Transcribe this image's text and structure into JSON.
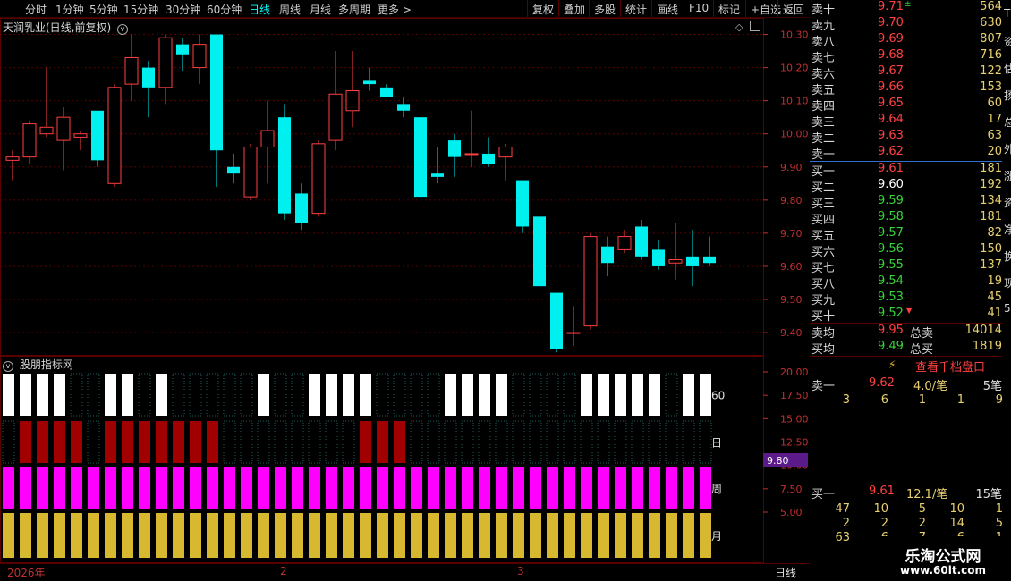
{
  "toolbar": {
    "periods": [
      "分时",
      "1分钟",
      "5分钟",
      "15分钟",
      "30分钟",
      "60分钟",
      "日线",
      "周线",
      "月线",
      "多周期",
      "更多 >"
    ],
    "active_period": "日线",
    "buttons": [
      "复权",
      "叠加",
      "多股",
      "统计",
      "画线",
      "F10",
      "标记",
      "+自选",
      "返回"
    ]
  },
  "main_chart": {
    "title": "天润乳业(日线,前复权)",
    "y_ticks": [
      "10.30",
      "10.20",
      "10.10",
      "10.00",
      "9.90",
      "9.80",
      "9.70",
      "9.60",
      "9.50",
      "9.40"
    ]
  },
  "sub_chart": {
    "title": "股朋指标网",
    "y_ticks": [
      "20.00",
      "17.50",
      "15.00",
      "12.50",
      "10.00",
      "7.50",
      "5.00"
    ],
    "row_labels": [
      "60",
      "日",
      "周",
      "月"
    ],
    "current_price_tag": "9.80"
  },
  "footer": {
    "date_labels": [
      "2026年",
      "2",
      "3"
    ],
    "period": "日线"
  },
  "order_book": {
    "asks": [
      {
        "label": "卖十",
        "price": "9.71",
        "vol": "564",
        "mark": "±"
      },
      {
        "label": "卖九",
        "price": "9.70",
        "vol": "630"
      },
      {
        "label": "卖八",
        "price": "9.69",
        "vol": "807"
      },
      {
        "label": "卖七",
        "price": "9.68",
        "vol": "716"
      },
      {
        "label": "卖六",
        "price": "9.67",
        "vol": "122"
      },
      {
        "label": "卖五",
        "price": "9.66",
        "vol": "153"
      },
      {
        "label": "卖四",
        "price": "9.65",
        "vol": "60"
      },
      {
        "label": "卖三",
        "price": "9.64",
        "vol": "17"
      },
      {
        "label": "卖二",
        "price": "9.63",
        "vol": "63"
      },
      {
        "label": "卖一",
        "price": "9.62",
        "vol": "20"
      }
    ],
    "bids": [
      {
        "label": "买一",
        "price": "9.61",
        "vol": "181"
      },
      {
        "label": "买二",
        "price": "9.60",
        "vol": "192"
      },
      {
        "label": "买三",
        "price": "9.59",
        "vol": "134"
      },
      {
        "label": "买四",
        "price": "9.58",
        "vol": "181"
      },
      {
        "label": "买五",
        "price": "9.57",
        "vol": "82"
      },
      {
        "label": "买六",
        "price": "9.56",
        "vol": "150"
      },
      {
        "label": "买七",
        "price": "9.55",
        "vol": "137"
      },
      {
        "label": "买八",
        "price": "9.54",
        "vol": "19"
      },
      {
        "label": "买九",
        "price": "9.53",
        "vol": "45"
      },
      {
        "label": "买十",
        "price": "9.52",
        "vol": "41"
      }
    ],
    "ask_avg_label": "卖均",
    "ask_avg": "9.95",
    "ask_total_label": "总卖",
    "ask_total": "14014",
    "bid_avg_label": "买均",
    "bid_avg": "9.49",
    "bid_total_label": "总买",
    "bid_total": "1819",
    "thousand_link": "查看千档盘口",
    "sell1_label": "卖一",
    "sell1_price": "9.62",
    "sell1_avg": "4.0/笔",
    "sell1_count": "5笔",
    "sell1_queue": [
      "3",
      "6",
      "1",
      "1",
      "9"
    ],
    "buy1_label": "买一",
    "buy1_price": "9.61",
    "buy1_avg": "12.1/笔",
    "buy1_count": "15笔",
    "buy1_queue": [
      [
        "47",
        "10",
        "5",
        "10",
        "1"
      ],
      [
        "2",
        "2",
        "2",
        "14",
        "5"
      ],
      [
        "63",
        "6",
        "7",
        "6",
        "1"
      ]
    ],
    "side_chars": [
      "T",
      "资",
      "估",
      "扬",
      "总",
      "外",
      "涨",
      "资",
      "净",
      "换",
      "现",
      "5"
    ]
  },
  "logo": {
    "title": "乐淘公式网",
    "url": "www.60lt.com"
  },
  "colors": {
    "up": "#ff4040",
    "down": "#00f0f0",
    "grid": "#5a0000",
    "bg": "#000000",
    "magenta": "#ff00ff",
    "gold": "#d8b830",
    "darkred": "#a00000"
  },
  "chart_data": {
    "type": "candlestick",
    "y_range": [
      9.33,
      10.35
    ],
    "candles": [
      {
        "o": 9.92,
        "h": 9.95,
        "l": 9.86,
        "c": 9.93
      },
      {
        "o": 9.93,
        "h": 10.04,
        "l": 9.91,
        "c": 10.03
      },
      {
        "o": 10.0,
        "h": 10.2,
        "l": 9.99,
        "c": 10.02
      },
      {
        "o": 9.98,
        "h": 10.08,
        "l": 9.89,
        "c": 10.05
      },
      {
        "o": 9.99,
        "h": 10.01,
        "l": 9.95,
        "c": 10.0
      },
      {
        "o": 10.07,
        "h": 10.07,
        "l": 9.9,
        "c": 9.92
      },
      {
        "o": 9.85,
        "h": 10.15,
        "l": 9.84,
        "c": 10.14
      },
      {
        "o": 10.15,
        "h": 10.3,
        "l": 10.1,
        "c": 10.23
      },
      {
        "o": 10.2,
        "h": 10.22,
        "l": 10.05,
        "c": 10.14
      },
      {
        "o": 10.14,
        "h": 10.3,
        "l": 10.09,
        "c": 10.29
      },
      {
        "o": 10.27,
        "h": 10.29,
        "l": 10.19,
        "c": 10.24
      },
      {
        "o": 10.2,
        "h": 10.3,
        "l": 10.15,
        "c": 10.27
      },
      {
        "o": 10.3,
        "h": 10.3,
        "l": 9.84,
        "c": 9.95
      },
      {
        "o": 9.9,
        "h": 9.94,
        "l": 9.85,
        "c": 9.88
      },
      {
        "o": 9.81,
        "h": 9.97,
        "l": 9.8,
        "c": 9.96
      },
      {
        "o": 9.96,
        "h": 10.1,
        "l": 9.85,
        "c": 10.01
      },
      {
        "o": 10.05,
        "h": 10.09,
        "l": 9.74,
        "c": 9.76
      },
      {
        "o": 9.82,
        "h": 9.85,
        "l": 9.71,
        "c": 9.73
      },
      {
        "o": 9.76,
        "h": 9.98,
        "l": 9.75,
        "c": 9.97
      },
      {
        "o": 9.98,
        "h": 10.25,
        "l": 9.95,
        "c": 10.12
      },
      {
        "o": 10.07,
        "h": 10.25,
        "l": 10.02,
        "c": 10.13
      },
      {
        "o": 10.16,
        "h": 10.2,
        "l": 10.13,
        "c": 10.15
      },
      {
        "o": 10.14,
        "h": 10.15,
        "l": 10.11,
        "c": 10.11
      },
      {
        "o": 10.09,
        "h": 10.11,
        "l": 10.05,
        "c": 10.07
      },
      {
        "o": 10.05,
        "h": 10.05,
        "l": 9.81,
        "c": 9.81
      },
      {
        "o": 9.88,
        "h": 9.96,
        "l": 9.85,
        "c": 9.87
      },
      {
        "o": 9.98,
        "h": 10.0,
        "l": 9.87,
        "c": 9.93
      },
      {
        "o": 9.94,
        "h": 10.07,
        "l": 9.9,
        "c": 9.94
      },
      {
        "o": 9.94,
        "h": 9.99,
        "l": 9.9,
        "c": 9.91
      },
      {
        "o": 9.93,
        "h": 9.97,
        "l": 9.86,
        "c": 9.96
      },
      {
        "o": 9.86,
        "h": 9.86,
        "l": 9.7,
        "c": 9.72
      },
      {
        "o": 9.75,
        "h": 9.75,
        "l": 9.54,
        "c": 9.54
      },
      {
        "o": 9.52,
        "h": 9.52,
        "l": 9.34,
        "c": 9.35
      },
      {
        "o": 9.4,
        "h": 9.48,
        "l": 9.36,
        "c": 9.4
      },
      {
        "o": 9.42,
        "h": 9.7,
        "l": 9.41,
        "c": 9.69
      },
      {
        "o": 9.66,
        "h": 9.69,
        "l": 9.57,
        "c": 9.61
      },
      {
        "o": 9.65,
        "h": 9.71,
        "l": 9.64,
        "c": 9.69
      },
      {
        "o": 9.72,
        "h": 9.74,
        "l": 9.62,
        "c": 9.63
      },
      {
        "o": 9.65,
        "h": 9.68,
        "l": 9.59,
        "c": 9.6
      },
      {
        "o": 9.61,
        "h": 9.73,
        "l": 9.56,
        "c": 9.62
      },
      {
        "o": 9.63,
        "h": 9.71,
        "l": 9.54,
        "c": 9.6
      },
      {
        "o": 9.63,
        "h": 9.69,
        "l": 9.6,
        "c": 9.61
      }
    ],
    "indicator": {
      "row_60": [
        1,
        1,
        1,
        1,
        0,
        0,
        1,
        1,
        0,
        1,
        0,
        0,
        0,
        0,
        0,
        1,
        0,
        0,
        1,
        1,
        1,
        1,
        0,
        0,
        0,
        0,
        1,
        1,
        1,
        1,
        0,
        0,
        0,
        0,
        1,
        1,
        1,
        1,
        1,
        0,
        1,
        1
      ],
      "row_day": [
        0,
        1,
        1,
        1,
        1,
        0,
        1,
        1,
        1,
        1,
        1,
        1,
        1,
        0,
        0,
        0,
        0,
        0,
        0,
        0,
        0,
        1,
        1,
        1,
        0,
        0,
        0,
        0,
        0,
        0,
        0,
        0,
        0,
        0,
        0,
        0,
        0,
        0,
        0,
        0,
        0,
        0
      ],
      "row_week": [
        1,
        1,
        1,
        1,
        1,
        1,
        1,
        1,
        1,
        1,
        1,
        1,
        1,
        1,
        1,
        1,
        1,
        1,
        1,
        1,
        1,
        1,
        1,
        1,
        1,
        1,
        1,
        1,
        1,
        1,
        1,
        1,
        1,
        1,
        1,
        1,
        1,
        1,
        1,
        1,
        1,
        1
      ],
      "row_month": [
        1,
        1,
        1,
        1,
        1,
        1,
        1,
        1,
        1,
        1,
        1,
        1,
        1,
        1,
        1,
        1,
        1,
        1,
        1,
        1,
        1,
        1,
        1,
        1,
        1,
        1,
        1,
        1,
        1,
        1,
        1,
        1,
        1,
        1,
        1,
        1,
        1,
        1,
        1,
        1,
        1,
        1
      ]
    }
  }
}
